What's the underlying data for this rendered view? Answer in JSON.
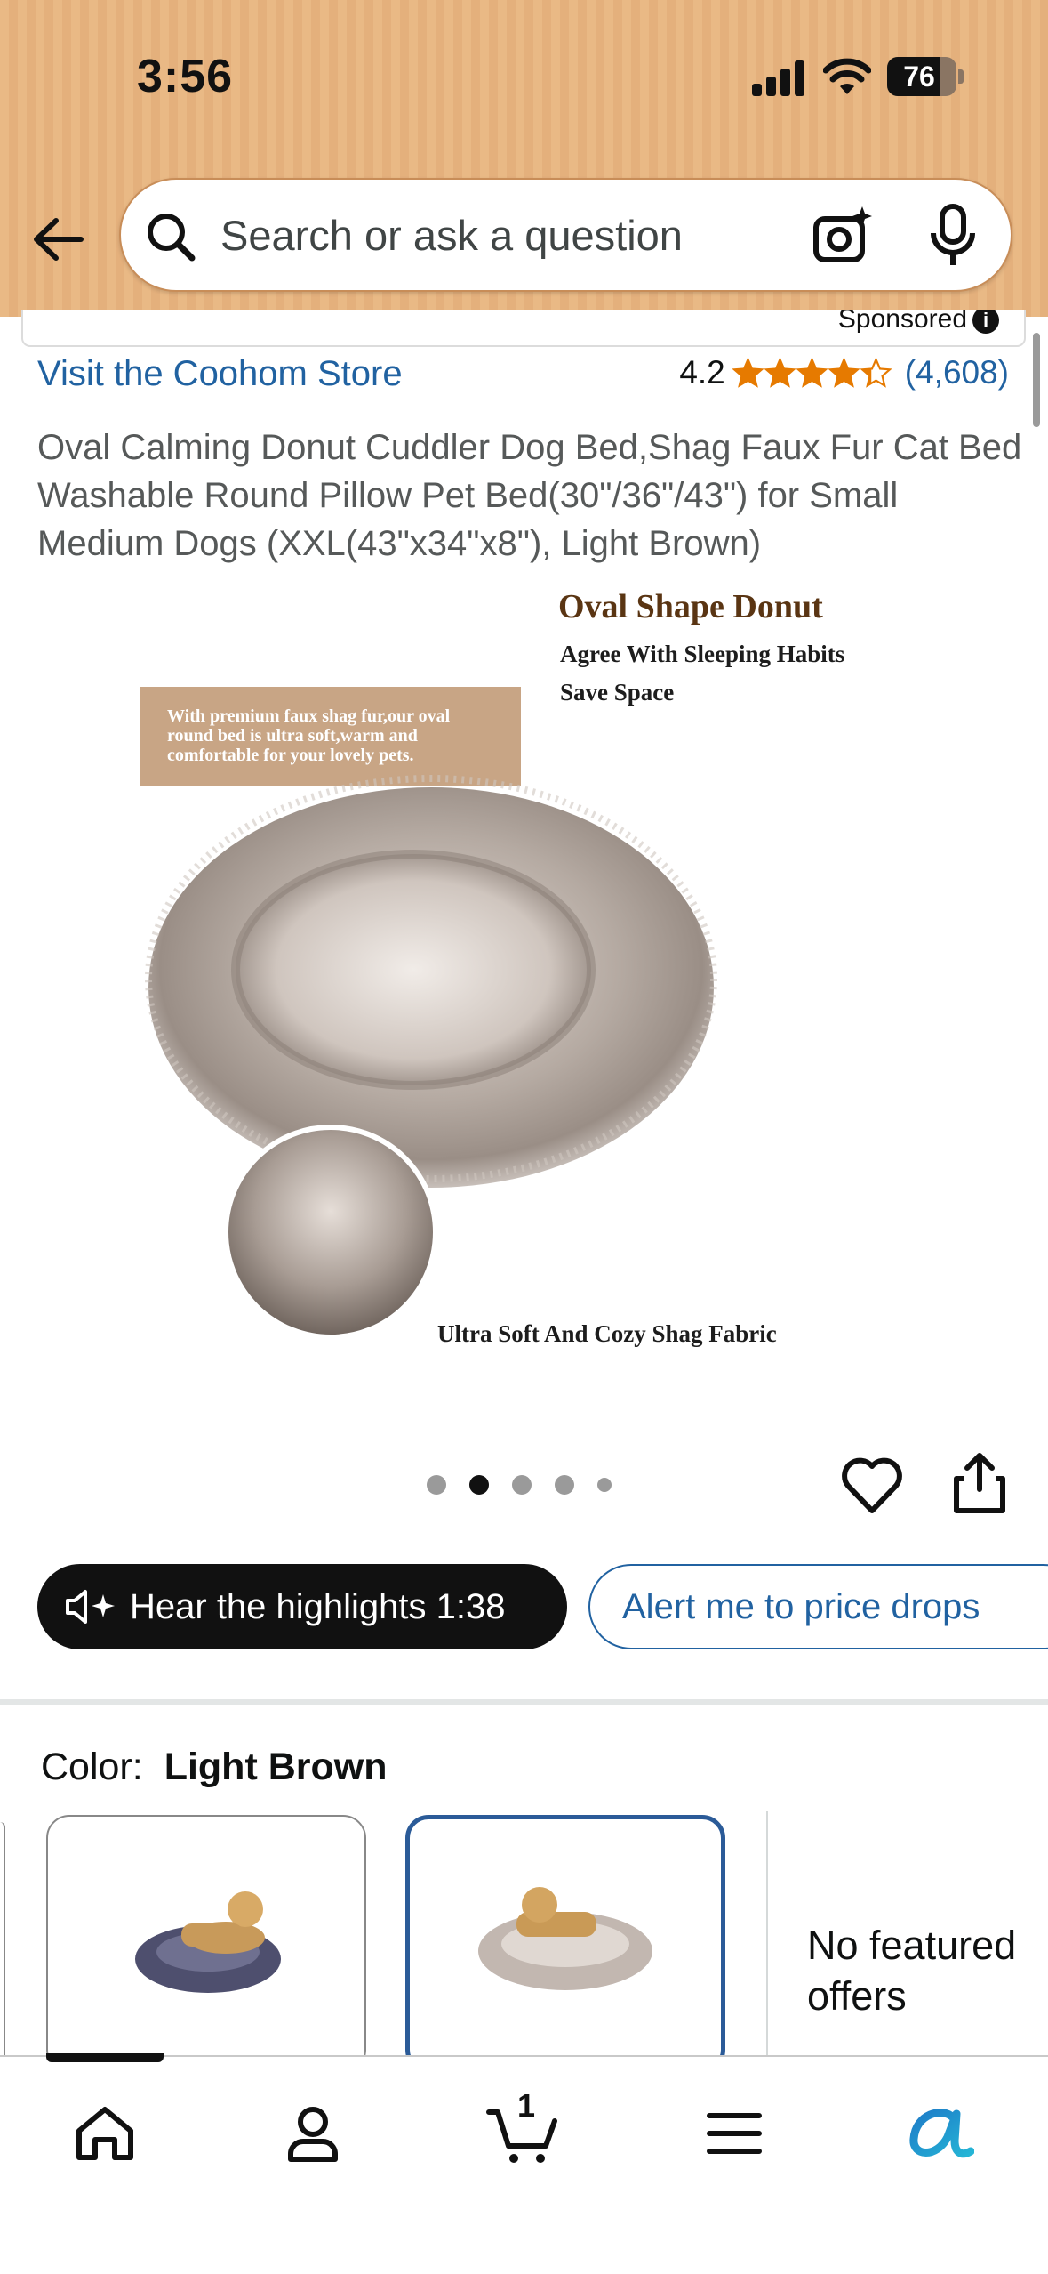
{
  "status_bar": {
    "time": "3:56",
    "battery": "76"
  },
  "search": {
    "placeholder": "Search or ask a question"
  },
  "sponsored": {
    "label": "Sponsored"
  },
  "product": {
    "store_link": "Visit the Coohom Store",
    "rating": "4.2",
    "rating_stars": 4.2,
    "rating_count": "(4,608)",
    "title": "Oval Calming Donut Cuddler Dog Bed,Shag Faux Fur Cat Bed Washable Round Pillow Pet Bed(30\"/36\"/43\") for Small Medium Dogs (XXL(43\"x34\"x8\"), Light Brown)"
  },
  "image": {
    "heading": "Oval Shape Donut",
    "sub1": "Agree With Sleeping Habits",
    "sub2": "Save Space",
    "box_text": "With premium faux shag fur,our oval round bed is ultra soft,warm and comfortable for your lovely pets.",
    "caption": "Ultra Soft And Cozy Shag Fabric"
  },
  "carousel": {
    "count": 5,
    "active_index": 1
  },
  "actions": {
    "hear_label": "Hear the highlights 1:38",
    "alert_label": "Alert me to price drops"
  },
  "color": {
    "label": "Color:",
    "value": "Light Brown"
  },
  "offers": {
    "text": "No featured offers"
  },
  "nav": {
    "items": [
      "home-icon",
      "account-icon",
      "cart-icon",
      "menu-icon",
      "rufus-icon"
    ],
    "cart_count": "1"
  },
  "colors": {
    "accent_link": "#2162a1",
    "star": "#e67a00",
    "header_bg": "#e9b985"
  }
}
